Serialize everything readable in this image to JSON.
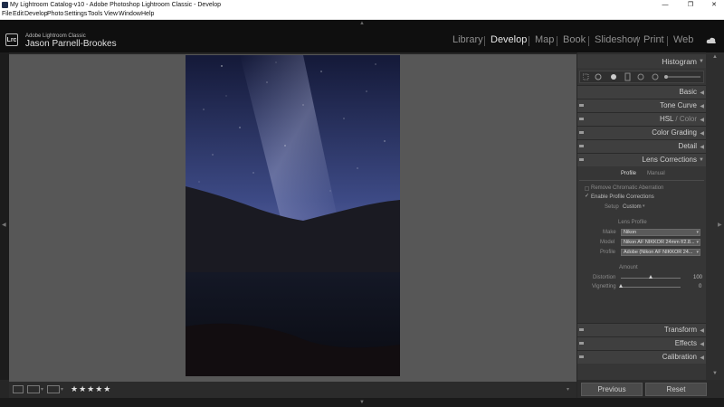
{
  "window": {
    "title": "My Lightroom Catalog-v10 - Adobe Photoshop Lightroom Classic - Develop",
    "minimize": "—",
    "maximize": "❐",
    "close": "✕"
  },
  "menu": [
    "File",
    "Edit",
    "Develop",
    "Photo",
    "Settings",
    "Tools",
    "View",
    "Window",
    "Help"
  ],
  "identity": {
    "logo": "Lrc",
    "app": "Adobe Lightroom Classic",
    "user": "Jason Parnell-Brookes"
  },
  "modules": [
    "Library",
    "Develop",
    "Map",
    "Book",
    "Slideshow",
    "Print",
    "Web"
  ],
  "active_module": "Develop",
  "toolbar": {
    "rating": "★★★★★"
  },
  "panels": {
    "histogram": "Histogram",
    "basic": "Basic",
    "tone_curve": "Tone Curve",
    "hsl_a": "HSL",
    "hsl_sep": " / ",
    "hsl_b": "Color",
    "color_grading": "Color Grading",
    "detail": "Detail",
    "lens_corrections": "Lens Corrections",
    "transform": "Transform",
    "effects": "Effects",
    "calibration": "Calibration"
  },
  "lens": {
    "tab_profile": "Profile",
    "tab_manual": "Manual",
    "remove_ca": "Remove Chromatic Aberration",
    "enable_profile": "Enable Profile Corrections",
    "setup_label": "Setup",
    "setup_value": "Custom",
    "lens_profile_heading": "Lens Profile",
    "make_label": "Make",
    "make_value": "Nikon",
    "model_label": "Model",
    "model_value": "Nikon AF NIKKOR 24mm f/2.8...",
    "profile_label": "Profile",
    "profile_value": "Adobe (Nikon AF NIKKOR 24...",
    "amount_heading": "Amount",
    "distortion_label": "Distortion",
    "distortion_value": "100",
    "vignetting_label": "Vignetting",
    "vignetting_value": "0",
    "distortion_level": 100,
    "vignetting_level": 0
  },
  "buttons": {
    "previous": "Previous",
    "reset": "Reset"
  },
  "colors": {
    "panel_bg": "#363636",
    "canvas_bg": "#575757",
    "accent": "#e6e6e6"
  }
}
